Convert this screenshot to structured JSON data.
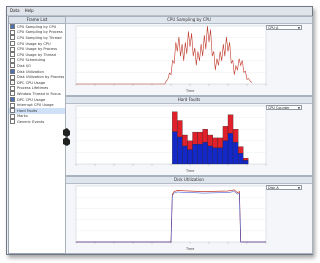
{
  "window": {
    "menus": [
      "Data",
      "Help"
    ]
  },
  "frame_list": {
    "header": "Frame List",
    "items": [
      {
        "label": "CPU Sampling by CPU",
        "checked": true
      },
      {
        "label": "CPU Sampling by Process",
        "checked": false
      },
      {
        "label": "CPU Sampling by Thread",
        "checked": false
      },
      {
        "label": "CPU Usage by CPU",
        "checked": false
      },
      {
        "label": "CPU Usage by Process",
        "checked": false
      },
      {
        "label": "CPU Usage by Thread",
        "checked": false
      },
      {
        "label": "CPU Scheduling",
        "checked": false
      },
      {
        "label": "Disk I/O",
        "checked": false
      },
      {
        "label": "Disk Utilization",
        "checked": true
      },
      {
        "label": "Disk Utilization by Process",
        "checked": false
      },
      {
        "label": "DPC CPU Usage",
        "checked": false
      },
      {
        "label": "Process Lifetimes",
        "checked": false
      },
      {
        "label": "Window Thread in Focus",
        "checked": false
      },
      {
        "label": "DPC CPU Usage",
        "checked": true
      },
      {
        "label": "Interrupt CPU Usage",
        "checked": false
      },
      {
        "label": "Hard Faults",
        "checked": false,
        "selected": true
      },
      {
        "label": "Marks",
        "checked": false
      },
      {
        "label": "Generic Events",
        "checked": false
      }
    ]
  },
  "panels": [
    {
      "title": "CPU Sampling by CPU",
      "dropdown": "CPU A",
      "x_label": "Time"
    },
    {
      "title": "Hard Faults",
      "dropdown": "CPU Counter",
      "x_label": "Time"
    },
    {
      "title": "Disk Utilization",
      "dropdown": "Disk A",
      "x_label": "Time"
    }
  ],
  "colors": {
    "line": "#c0392b",
    "bar_red": "#e0202a",
    "bar_blue": "#1428c8",
    "line_blue": "#2040d0"
  },
  "chart_data": [
    {
      "type": "line",
      "x": [
        0,
        10,
        20,
        30,
        40,
        50,
        60,
        70,
        80,
        90,
        100,
        110,
        120,
        130,
        140,
        150,
        160,
        170,
        180,
        190,
        200,
        210,
        220,
        230,
        240,
        250,
        260,
        270,
        280
      ],
      "values": [
        0,
        0,
        0,
        0,
        0,
        0,
        0,
        0,
        0,
        0,
        0,
        0,
        0,
        0,
        0,
        0.2,
        0.7,
        0.5,
        0.8,
        0.4,
        0.6,
        0.9,
        0.3,
        0.5,
        0.7,
        0.2,
        0.4,
        0.1,
        0
      ],
      "xlim": [
        0,
        300
      ]
    },
    {
      "type": "bar",
      "x": [
        152,
        160,
        168,
        176,
        184,
        192,
        200,
        208,
        216,
        224,
        232,
        240,
        248,
        256,
        264
      ],
      "series": [
        {
          "name": "",
          "values": [
            0.9,
            0.75,
            0.5,
            0.4,
            0.55,
            0.55,
            0.6,
            0.5,
            0.45,
            0.45,
            0.65,
            0.85,
            0.6,
            0.3,
            0.1
          ]
        },
        {
          "name": "",
          "values": [
            0.25,
            0.2,
            0.15,
            0.1,
            0.15,
            0.15,
            0.15,
            0.15,
            0.15,
            0.1,
            0.2,
            0.2,
            0.15,
            0.1,
            0.05
          ]
        }
      ],
      "xlim": [
        0,
        300
      ]
    },
    {
      "type": "line",
      "x": [
        0,
        100,
        150,
        152,
        155,
        160,
        200,
        240,
        250,
        255,
        258,
        260,
        300
      ],
      "values": [
        0,
        0,
        0,
        0.85,
        0.9,
        0.92,
        0.9,
        0.91,
        0.93,
        0.88,
        0.9,
        0,
        0
      ],
      "xlim": [
        0,
        300
      ]
    }
  ]
}
